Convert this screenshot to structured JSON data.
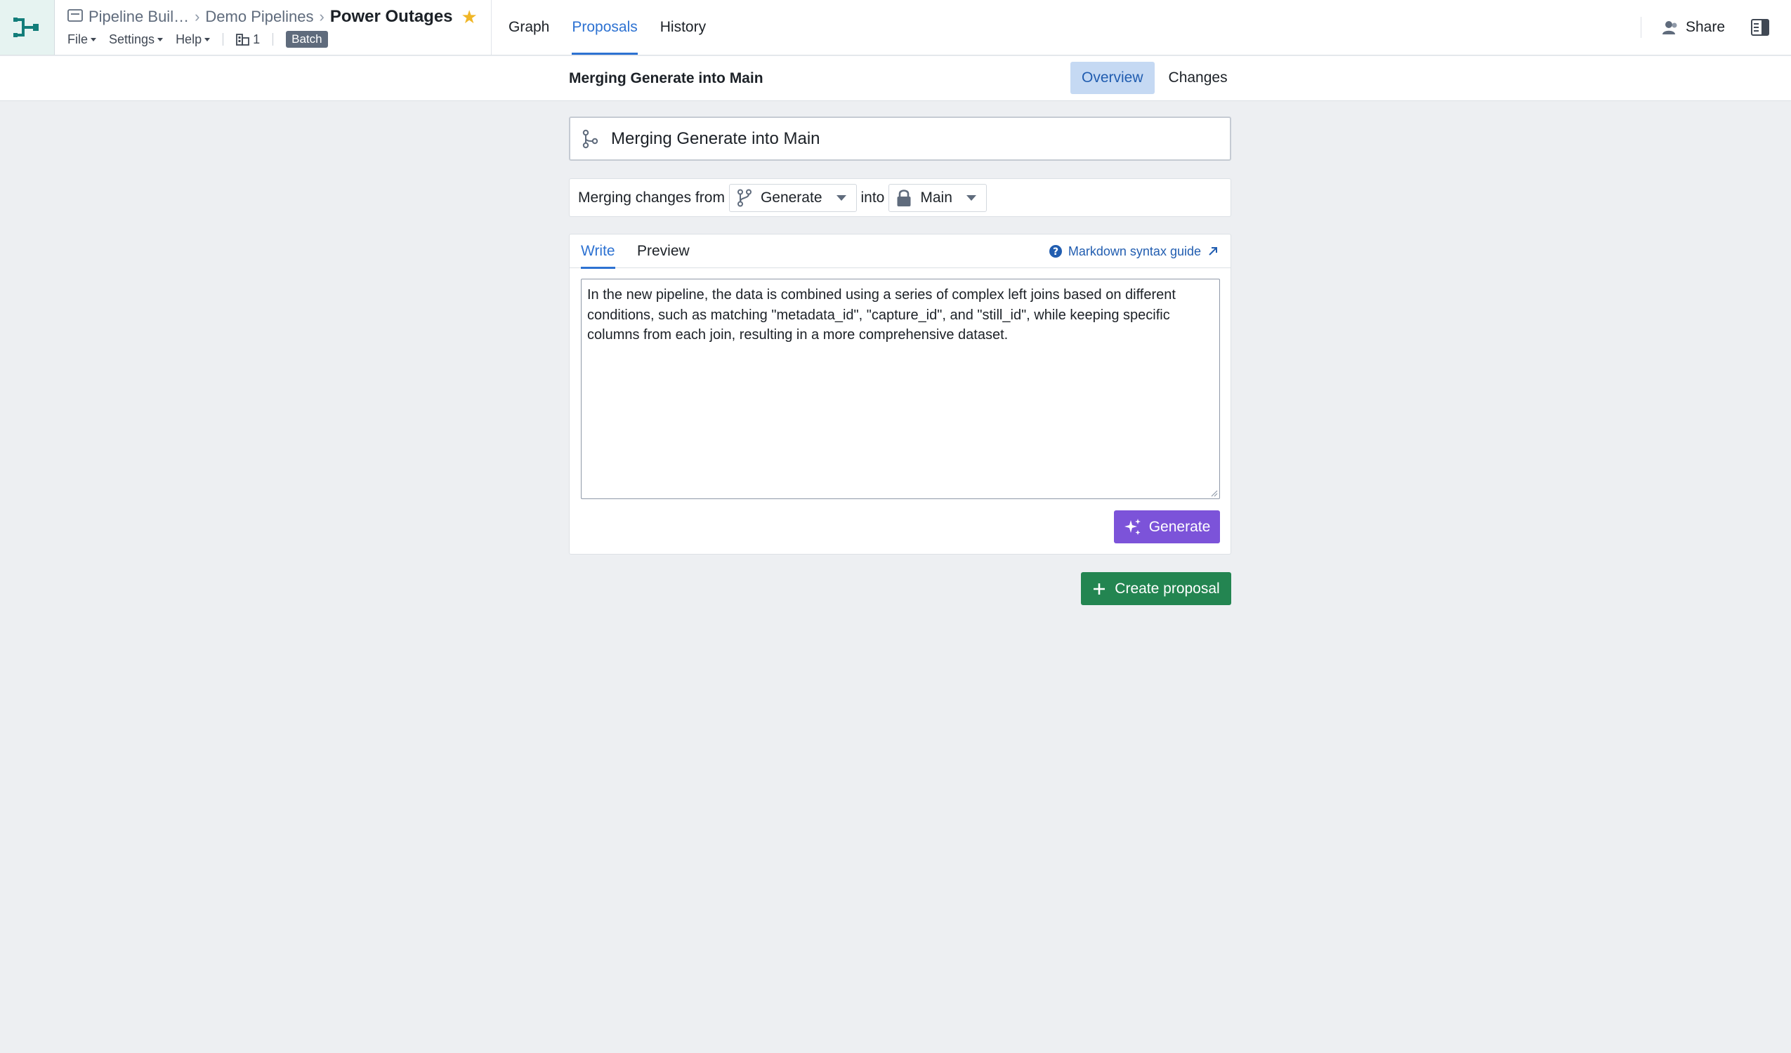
{
  "header": {
    "breadcrumbs": [
      "Pipeline Buil…",
      "Demo Pipelines"
    ],
    "title": "Power Outages",
    "menus": [
      "File",
      "Settings",
      "Help"
    ],
    "build_count": "1",
    "mode_badge": "Batch",
    "nav_tabs": [
      {
        "label": "Graph",
        "active": false
      },
      {
        "label": "Proposals",
        "active": true
      },
      {
        "label": "History",
        "active": false
      }
    ],
    "share_label": "Share"
  },
  "subheader": {
    "title": "Merging Generate into Main",
    "tabs": [
      {
        "label": "Overview",
        "active": true
      },
      {
        "label": "Changes",
        "active": false
      }
    ]
  },
  "proposal": {
    "title_value": "Merging Generate into Main",
    "merge_prefix": "Merging changes from",
    "source_branch": "Generate",
    "into_label": "into",
    "target_branch": "Main",
    "editor_tabs": [
      {
        "label": "Write",
        "active": true
      },
      {
        "label": "Preview",
        "active": false
      }
    ],
    "markdown_link": "Markdown syntax guide",
    "description": "In the new pipeline, the data is combined using a series of complex left joins based on different conditions, such as matching \"metadata_id\", \"capture_id\", and \"still_id\", while keeping specific columns from each join, resulting in a more comprehensive dataset.",
    "generate_label": "Generate",
    "create_label": "Create proposal"
  },
  "colors": {
    "accent": "#2d72d2",
    "generate": "#7c53d9",
    "create": "#238551",
    "star": "#f0b626"
  },
  "icons": [
    "pipeline-logo-icon",
    "folder-icon",
    "star-icon",
    "build-icon",
    "user-share-icon",
    "panel-toggle-icon",
    "git-branch-icon",
    "lock-icon",
    "help-icon",
    "external-link-icon",
    "sparkle-icon",
    "plus-icon"
  ]
}
